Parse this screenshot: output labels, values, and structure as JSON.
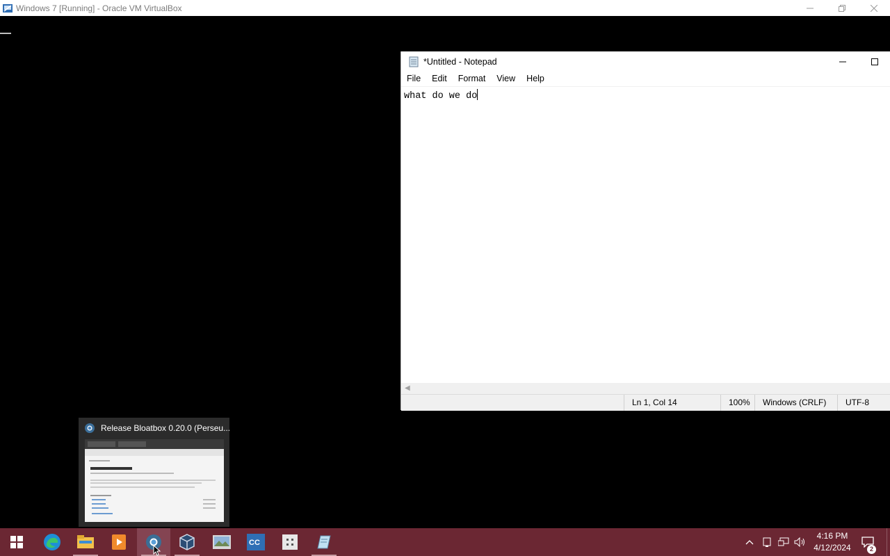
{
  "host_window": {
    "title": "Windows 7 [Running] - Oracle VM VirtualBox",
    "icon": "virtualbox-icon"
  },
  "notepad": {
    "title": "*Untitled - Notepad",
    "menu": [
      "File",
      "Edit",
      "Format",
      "View",
      "Help"
    ],
    "content": "what do we do",
    "status": {
      "position": "Ln 1, Col 14",
      "zoom": "100%",
      "line_ending": "Windows (CRLF)",
      "encoding": "UTF-8"
    }
  },
  "thumbnail": {
    "title": "Release Bloatbox 0.20.0 (Perseu...",
    "icon": "chromium-icon"
  },
  "taskbar": {
    "items": [
      {
        "name": "start-icon"
      },
      {
        "name": "edge-icon"
      },
      {
        "name": "file-explorer-icon"
      },
      {
        "name": "media-player-icon"
      },
      {
        "name": "browser-icon"
      },
      {
        "name": "virtualbox-icon"
      },
      {
        "name": "image-viewer-icon"
      },
      {
        "name": "ccleaner-icon"
      },
      {
        "name": "app-grid-icon"
      },
      {
        "name": "notepad-icon"
      }
    ],
    "clock_time": "4:16 PM",
    "clock_date": "4/12/2024",
    "notification_count": "2"
  },
  "colors": {
    "taskbar": "#6b2733",
    "taskbar_active": "#844452"
  }
}
